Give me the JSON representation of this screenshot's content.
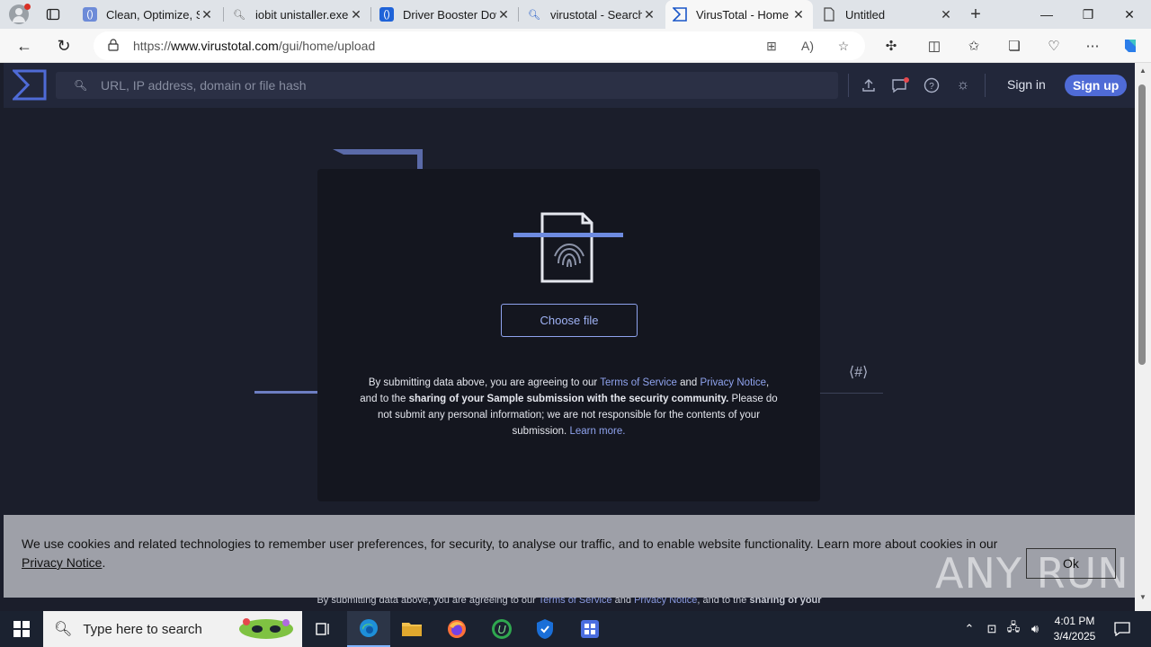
{
  "browser": {
    "tabs": [
      {
        "title": "Clean, Optimize, Sp",
        "icon": "code-brackets-icon"
      },
      {
        "title": "iobit unistaller.exe",
        "icon": "search-icon"
      },
      {
        "title": "Driver Booster Dow",
        "icon": "code-brackets-icon"
      },
      {
        "title": "virustotal - Search",
        "icon": "search-icon"
      },
      {
        "title": "VirusTotal - Home",
        "icon": "virustotal-icon"
      },
      {
        "title": "Untitled",
        "icon": "page-icon"
      }
    ],
    "url_prefix": "https://",
    "url_domain": "www.virustotal.com",
    "url_path": "/gui/home/upload"
  },
  "vt": {
    "search_placeholder": "URL, IP address, domain or file hash",
    "sign_in": "Sign in",
    "sign_up": "Sign up"
  },
  "modal": {
    "choose_file": "Choose file",
    "terms_1": "By submitting data above, you are agreeing to our ",
    "terms_link": "Terms of Service",
    "terms_2": " and ",
    "privacy_link": "Privacy Notice",
    "terms_3": ", and to the ",
    "terms_bold": "sharing of your Sample submission with the security community.",
    "terms_4": " Please do not submit any personal information; we are not responsible for the contents of your submission. ",
    "learn_more": "Learn more."
  },
  "background": {
    "bottom_1": "By submitting data above, you are agreeing to our ",
    "bottom_terms": "Terms of Service",
    "bottom_2": " and ",
    "bottom_privacy": "Privacy Notice",
    "bottom_3": ", and to the ",
    "bottom_bold": "sharing of your"
  },
  "cookie": {
    "text": "We use cookies and related technologies to remember user preferences, for security, to analyse our traffic, and to enable website functionality. Learn more about cookies in our ",
    "link": "Privacy Notice",
    "suffix": ".",
    "ok": "Ok",
    "watermark": "ANY RUN"
  },
  "taskbar": {
    "search_text": "Type here to search",
    "time": "4:01 PM",
    "date": "3/4/2025"
  },
  "colors": {
    "vt_accent": "#4f6bd6",
    "link": "#8fa3ee",
    "page_bg": "#1b1e2b",
    "modal_bg": "#14161f",
    "cookie_bg": "#9ea0a8"
  }
}
